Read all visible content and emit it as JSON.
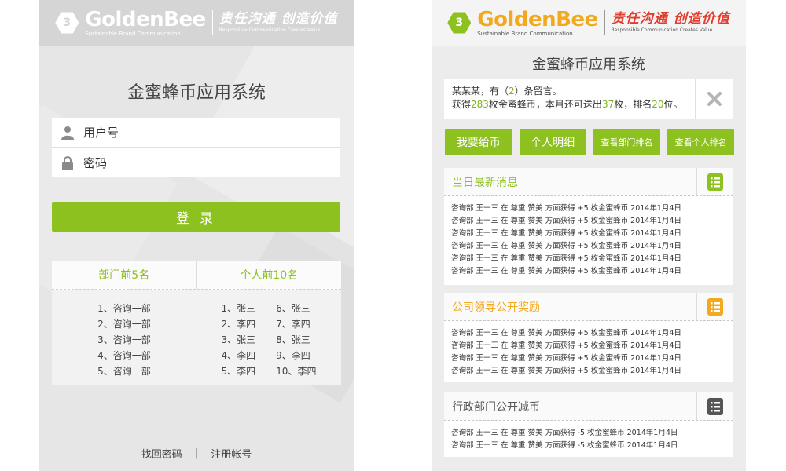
{
  "brand": {
    "name": "GoldenBee",
    "sub": "Sustainable Brand Communication",
    "slogan": "责任沟通 创造价值",
    "slogan_sub": "Responsible  Communication  Creates  Value"
  },
  "login": {
    "title": "金蜜蜂币应用系统",
    "username_placeholder": "用户号",
    "password_placeholder": "密码",
    "login_button": "登 录",
    "rank_tabs": [
      "部门前5名",
      "个人前10名"
    ],
    "departments": [
      "1、咨询一部",
      "2、咨询一部",
      "3、咨询一部",
      "4、咨询一部",
      "5、咨询一部"
    ],
    "people_a": [
      "1、张三",
      "2、李四",
      "3、张三",
      "4、李四",
      "5、李四"
    ],
    "people_b": [
      "6、张三",
      "7、李四",
      "8、张三",
      "9、李四",
      "10、李四"
    ],
    "forgot": "找回密码",
    "sep": "|",
    "register": "注册帐号"
  },
  "app": {
    "title": "金蜜蜂币应用系统",
    "notice": {
      "user": "某某某",
      "msg_prefix": "，有（",
      "msg_count": "2",
      "msg_suffix": "）条留言。",
      "earn_prefix": "获得",
      "earn_count": "283",
      "earn_mid": "枚金蜜蜂币，本月还可送出",
      "remain": "37",
      "rank_prefix": "枚，排名",
      "rank": "20",
      "rank_suffix": "位。"
    },
    "actions": [
      "我要给币",
      "个人明细",
      "查看部门排名",
      "查看个人排名"
    ],
    "panels": [
      {
        "title": "当日最新消息",
        "color": "#8cc11f",
        "items": [
          "咨询部 王一三 在 尊重 赞美 方面获得 +5 枚金蜜蜂币 2014年1月4日",
          "咨询部 王一三 在 尊重 赞美 方面获得 +5 枚金蜜蜂币 2014年1月4日",
          "咨询部 王一三 在 尊重 赞美 方面获得 +5 枚金蜜蜂币 2014年1月4日",
          "咨询部 王一三 在 尊重 赞美 方面获得 +5 枚金蜜蜂币 2014年1月4日",
          "咨询部 王一三 在 尊重 赞美 方面获得 +5 枚金蜜蜂币 2014年1月4日",
          "咨询部 王一三 在 尊重 赞美 方面获得 +5 枚金蜜蜂币 2014年1月4日"
        ]
      },
      {
        "title": "公司领导公开奖励",
        "color": "#f3a91d",
        "items": [
          "咨询部 王一三 在 尊重 赞美 方面获得 +5 枚金蜜蜂币 2014年1月4日",
          "咨询部 王一三 在 尊重 赞美 方面获得 +5 枚金蜜蜂币 2014年1月4日",
          "咨询部 王一三 在 尊重 赞美 方面获得 +5 枚金蜜蜂币 2014年1月4日",
          "咨询部 王一三 在 尊重 赞美 方面获得 +5 枚金蜜蜂币 2014年1月4日"
        ]
      },
      {
        "title": "行政部门公开减币",
        "color": "#555555",
        "items": [
          "咨询部 王一三 在 尊重 赞美 方面获得 -5 枚金蜜蜂币 2014年1月4日",
          "咨询部 王一三 在 尊重 赞美 方面获得 -5 枚金蜜蜂币 2014年1月4日"
        ]
      }
    ]
  },
  "colors": {
    "accent": "#8cc11f",
    "gold": "#f3a91d",
    "slogan_red": "#e23c2c"
  }
}
